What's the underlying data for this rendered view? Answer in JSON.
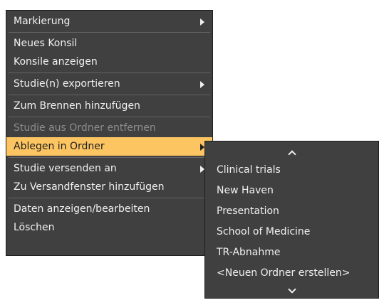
{
  "context_menu": {
    "items": [
      {
        "label": "Markierung",
        "submenu": true
      },
      {
        "label": "Neues Konsil"
      },
      {
        "label": "Konsile anzeigen"
      },
      {
        "label": "Studie(n) exportieren",
        "submenu": true
      },
      {
        "label": "Zum Brennen hinzufügen"
      },
      {
        "label": "Studie aus Ordner entfernen",
        "disabled": true
      },
      {
        "label": "Ablegen in Ordner",
        "submenu": true,
        "highlighted": true
      },
      {
        "label": "Studie versenden an",
        "submenu": true
      },
      {
        "label": "Zu Versandfenster hinzufügen"
      },
      {
        "label": "Daten anzeigen/bearbeiten"
      },
      {
        "label": "Löschen"
      }
    ]
  },
  "folder_submenu": {
    "items": [
      {
        "label": "Clinical trials"
      },
      {
        "label": "New Haven"
      },
      {
        "label": "Presentation"
      },
      {
        "label": "School of Medicine"
      },
      {
        "label": "TR-Abnahme"
      },
      {
        "label": "<Neuen Ordner erstellen>"
      }
    ]
  },
  "colors": {
    "menu_bg": "#404040",
    "highlight": "#fcc561",
    "text": "#f0f0f0",
    "disabled_text": "#8c8c8c"
  }
}
